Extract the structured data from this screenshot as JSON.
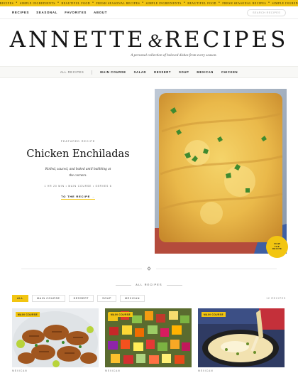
{
  "ticker": {
    "items": [
      "Recipes",
      "Simple Ingredients",
      "Beautiful Food",
      "Fresh Seasonal Recipes",
      "Simple Ingredients",
      "Beautiful Food",
      "Fresh Seasonal Recipes",
      "Simple Ingredients",
      "Beautiful Food",
      "Fresh Seasonal Recipes"
    ]
  },
  "topnav": {
    "links": [
      "Recipes",
      "Seasonal",
      "Favorites",
      "About"
    ],
    "search_placeholder": "Search recipes"
  },
  "masthead": {
    "title_left": "ANNETTE",
    "title_amp": "&",
    "title_right": "RECIPES",
    "tagline": "A personal collection of beloved dishes from every season."
  },
  "category_bar": {
    "items": [
      "All Recipes",
      "Main Course",
      "Salad",
      "Dessert",
      "Soup",
      "Mexican",
      "Chicken"
    ]
  },
  "featured": {
    "eyebrow": "Featured Recipe",
    "title": "Chicken Enchiladas",
    "description": "Rolled, sauced, and baked until bubbling at the corners.",
    "meta": "1 hr 20 min • Main Course • Serves 6",
    "link_label": "To the recipe",
    "link_arrow": "→",
    "badge_lines": [
      "View",
      "the",
      "Recipe"
    ]
  },
  "all_recipes": {
    "heading": "All Recipes",
    "filters": [
      "All",
      "Main Course",
      "Dessert",
      "Soup",
      "Mexican"
    ],
    "active_filter": "All",
    "count": "12 Recipes",
    "cards": [
      {
        "tag": "Main Course",
        "category": "Mexican"
      },
      {
        "tag": "Main Course",
        "category": "Mexican"
      },
      {
        "tag": "Main Course",
        "category": "Mexican"
      }
    ]
  },
  "icons": {
    "search": "search-icon",
    "divider": "diamond-ornament-icon"
  },
  "colors": {
    "accent": "#f2c511",
    "text": "#1c1c1c",
    "muted": "#777777"
  }
}
